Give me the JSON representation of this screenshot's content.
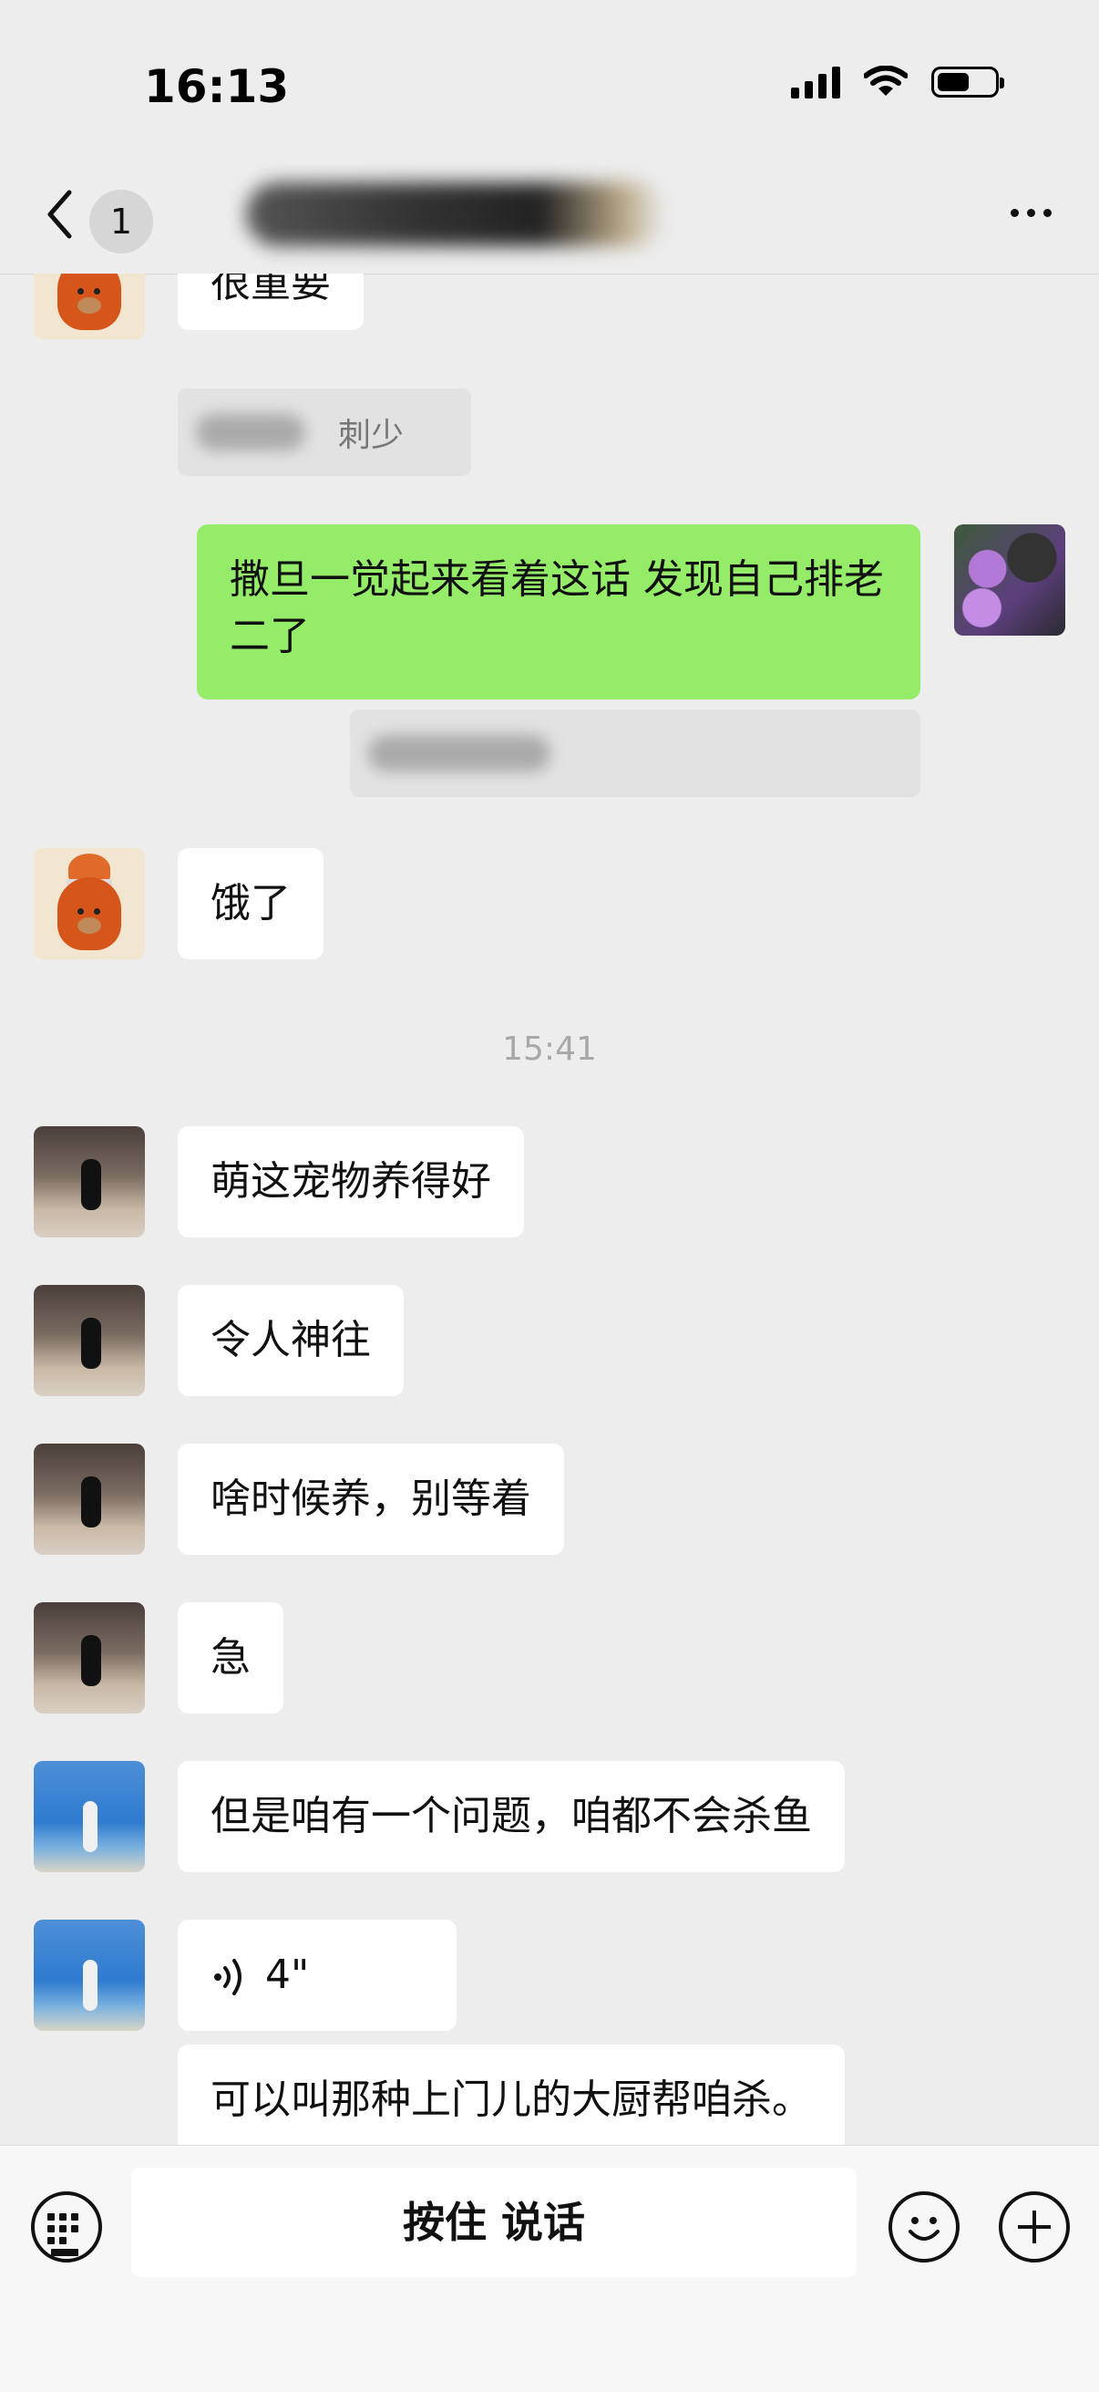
{
  "status_bar": {
    "time": "16:13",
    "icons": [
      "cellular-signal-icon",
      "wifi-icon",
      "battery-icon"
    ]
  },
  "nav": {
    "back_icon": "chevron-left-icon",
    "unread_count": "1",
    "title": "",
    "more_icon": "more-dots-icon"
  },
  "messages": [
    {
      "type": "received",
      "avatar": "bear-avatar",
      "text": "很重要"
    },
    {
      "type": "quote",
      "text": "刺少"
    },
    {
      "type": "sent",
      "avatar": "flowers-avatar",
      "text": "撒旦一觉起来看着这话 发现自己排老二了"
    },
    {
      "type": "quote-sent",
      "text": ""
    },
    {
      "type": "received",
      "avatar": "bear-avatar",
      "text": "饿了"
    },
    {
      "type": "timestamp",
      "text": "15:41"
    },
    {
      "type": "received",
      "avatar": "runner-avatar",
      "text": "萌这宠物养得好"
    },
    {
      "type": "received",
      "avatar": "runner-avatar",
      "text": "令人神往"
    },
    {
      "type": "received",
      "avatar": "runner-avatar",
      "text": "啥时候养，别等着"
    },
    {
      "type": "received",
      "avatar": "runner-avatar",
      "text": "急"
    },
    {
      "type": "received",
      "avatar": "sea-avatar",
      "text": "但是咱有一个问题，咱都不会杀鱼"
    },
    {
      "type": "voice",
      "avatar": "sea-avatar",
      "duration": "4\""
    },
    {
      "type": "received-continuation",
      "text": "可以叫那种上门儿的大厨帮咱杀。"
    }
  ],
  "input_bar": {
    "keyboard_icon": "keyboard-icon",
    "hold_to_talk_label": "按住 说话",
    "emoji_icon": "emoji-icon",
    "plus_icon": "plus-icon"
  },
  "colors": {
    "background": "#ededed",
    "sent_bubble": "#95ec69",
    "received_bubble": "#ffffff",
    "timestamp_text": "#a8a8a8"
  }
}
